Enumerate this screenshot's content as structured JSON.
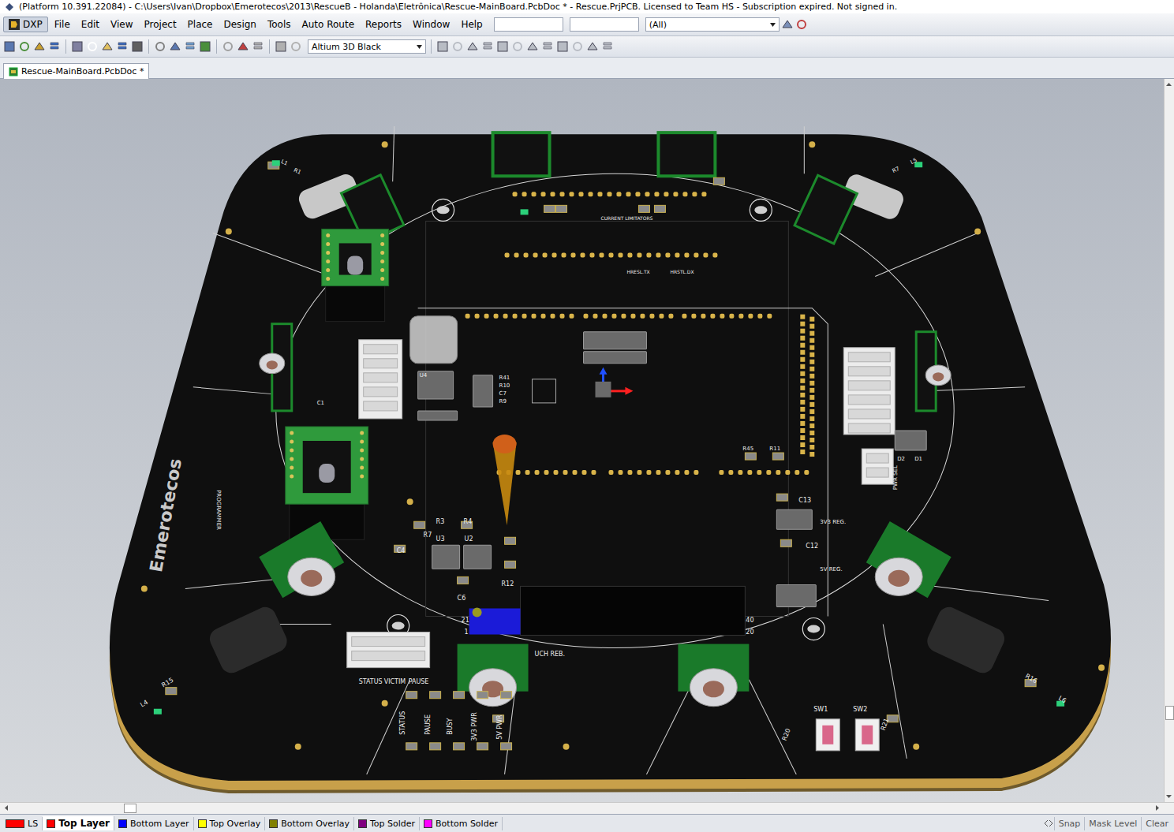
{
  "window": {
    "title": "(Platform 10.391.22084) - C:\\Users\\Ivan\\Dropbox\\Emerotecos\\2013\\RescueB - Holanda\\Eletrônica\\Rescue-MainBoard.PcbDoc * - Rescue.PrjPCB. Licensed to Team HS - Subscription expired. Not signed in."
  },
  "menu": [
    {
      "label": "DXP"
    },
    {
      "label": "File"
    },
    {
      "label": "Edit"
    },
    {
      "label": "View"
    },
    {
      "label": "Project"
    },
    {
      "label": "Place"
    },
    {
      "label": "Design"
    },
    {
      "label": "Tools"
    },
    {
      "label": "Auto Route"
    },
    {
      "label": "Reports"
    },
    {
      "label": "Window"
    },
    {
      "label": "Help"
    }
  ],
  "filter": {
    "value": "(All)"
  },
  "toolbar": {
    "view_config": "Altium 3D Black"
  },
  "document_tabs": [
    {
      "label": "Rescue-MainBoard.PcbDoc *",
      "selected": true
    }
  ],
  "board": {
    "labels": [
      "Emerotecos",
      "STATUS",
      "VICTIM",
      "PAUSE",
      "STATUS",
      "PAUSE",
      "BUSY",
      "3V3 PWR",
      "5V PWR",
      "SW1",
      "SW2",
      "R20",
      "R21",
      "3V3 REG.",
      "5V REG.",
      "C13",
      "C12",
      "R45",
      "R11",
      "D2",
      "D1",
      "R16",
      "L6",
      "R15",
      "L4",
      "R1",
      "L1",
      "R7",
      "L5",
      "R41",
      "R10",
      "C7",
      "R9",
      "U4",
      "C1",
      "R3",
      "R4",
      "R7",
      "U3",
      "U2",
      "C4",
      "R12",
      "C6",
      "21",
      "40",
      "20",
      "1",
      "UCH REB.",
      "CURRENT LIMITATORS",
      "HRESL.TX",
      "HRSTL.DX",
      "PROGRAMMER",
      "PWR SEL"
    ]
  },
  "layer_tabs": [
    {
      "label": "LS",
      "selected": false,
      "color": "#ff0000"
    },
    {
      "label": "Top Layer",
      "selected": true,
      "color": "#ff0000"
    },
    {
      "label": "Bottom Layer",
      "selected": false,
      "color": "#0000ff"
    },
    {
      "label": "Top Overlay",
      "selected": false,
      "color": "#ffff00"
    },
    {
      "label": "Bottom Overlay",
      "selected": false,
      "color": "#808000"
    },
    {
      "label": "Top Solder",
      "selected": false,
      "color": "#800080"
    },
    {
      "label": "Bottom Solder",
      "selected": false,
      "color": "#ff00ff"
    }
  ],
  "status_buttons": [
    "Snap",
    "Mask Level",
    "Clear"
  ]
}
